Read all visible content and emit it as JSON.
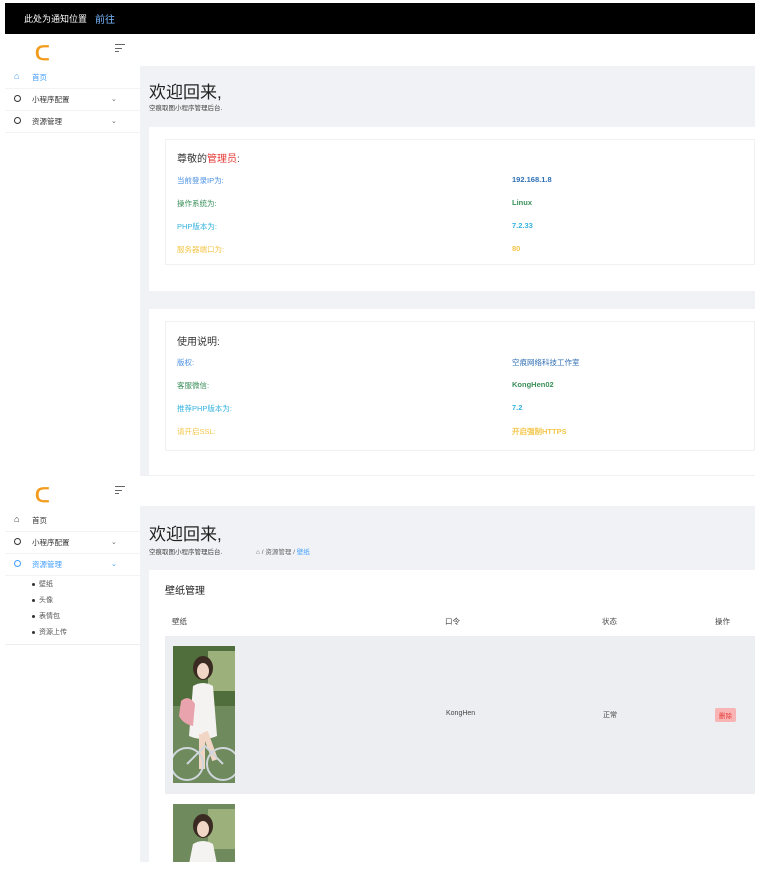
{
  "notice": {
    "text": "此处为通知位置",
    "link": "前往"
  },
  "logo": "ᑕ",
  "panel1": {
    "menu": [
      {
        "label": "首页"
      },
      {
        "label": "小程序配置"
      },
      {
        "label": "资源管理"
      }
    ],
    "welcome_title": "欢迎回来,",
    "welcome_sub": "空痕取图小程序管理后台.",
    "info_card": {
      "title_prefix": "尊敬的",
      "title_highlight": "管理员",
      "title_suffix": ":",
      "rows": [
        {
          "key": "当前登录IP为:",
          "value": "192.168.1.8"
        },
        {
          "key": "操作系统为:",
          "value": "Linux"
        },
        {
          "key": "PHP版本为:",
          "value": "7.2.33"
        },
        {
          "key": "服务器端口为:",
          "value": "80"
        }
      ]
    },
    "usage_card": {
      "title": "使用说明:",
      "rows": [
        {
          "key": "版权:",
          "value": "空痕网络科技工作室"
        },
        {
          "key": "客服微信:",
          "value": "KongHen02"
        },
        {
          "key": "推荐PHP版本为:",
          "value": "7.2"
        },
        {
          "key": "请开启SSL:",
          "value": "开启强制HTTPS"
        }
      ]
    }
  },
  "panel2": {
    "menu": [
      {
        "label": "首页"
      },
      {
        "label": "小程序配置"
      },
      {
        "label": "资源管理"
      }
    ],
    "submenu": [
      {
        "label": "壁纸"
      },
      {
        "label": "头像"
      },
      {
        "label": "表情包"
      },
      {
        "label": "资源上传"
      }
    ],
    "welcome_title": "欢迎回来,",
    "welcome_sub": "空痕取图小程序管理后台.",
    "breadcrumb": {
      "home_icon": "home-icon",
      "mid": "/ 资源管理 /",
      "current": "壁纸"
    },
    "table": {
      "title": "壁纸管理",
      "headers": [
        "壁纸",
        "口令",
        "状态",
        "操作"
      ],
      "rows": [
        {
          "code": "KongHen",
          "status": "正常",
          "action": "删除"
        }
      ]
    }
  },
  "colors": {
    "accent": "#409eff",
    "logo": "#f29b1d",
    "danger": "#e53935"
  }
}
